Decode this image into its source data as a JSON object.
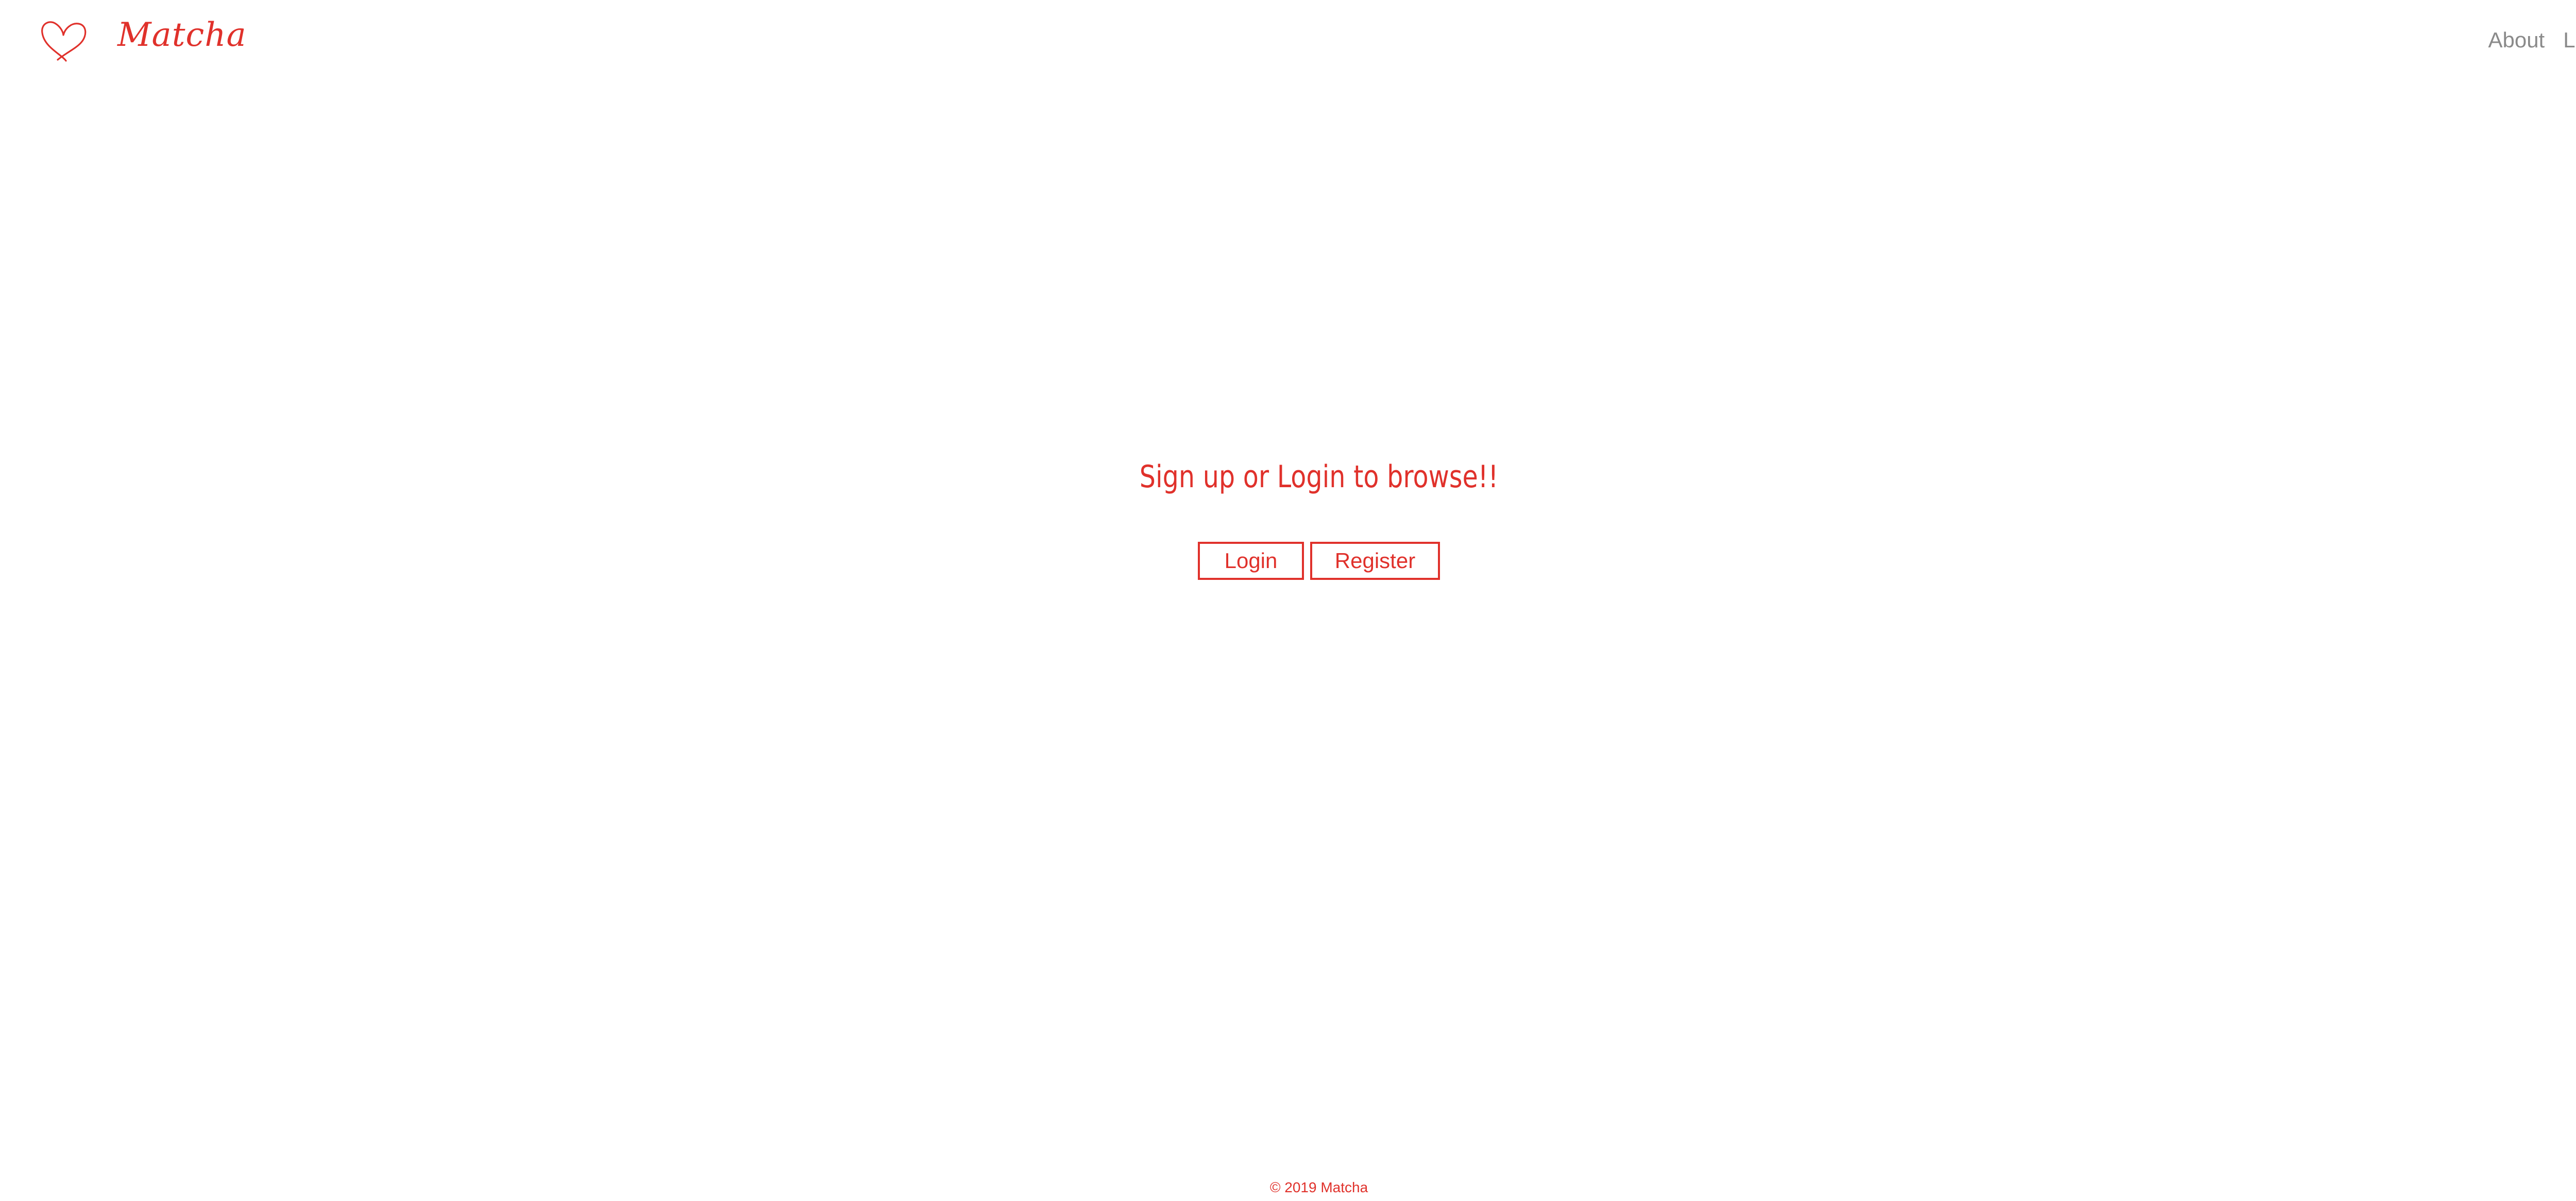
{
  "header": {
    "brand": "Matcha",
    "logo_icon": "heart-icon",
    "nav": [
      {
        "label": "About"
      },
      {
        "label": "Login"
      }
    ]
  },
  "main": {
    "prompt": "Sign up or Login to browse!!",
    "login_label": "Login",
    "register_label": "Register"
  },
  "footer": {
    "text": "© 2019 Matcha"
  },
  "colors": {
    "accent": "#e0312b",
    "nav_text": "#8a8a8a",
    "background": "#ffffff"
  }
}
